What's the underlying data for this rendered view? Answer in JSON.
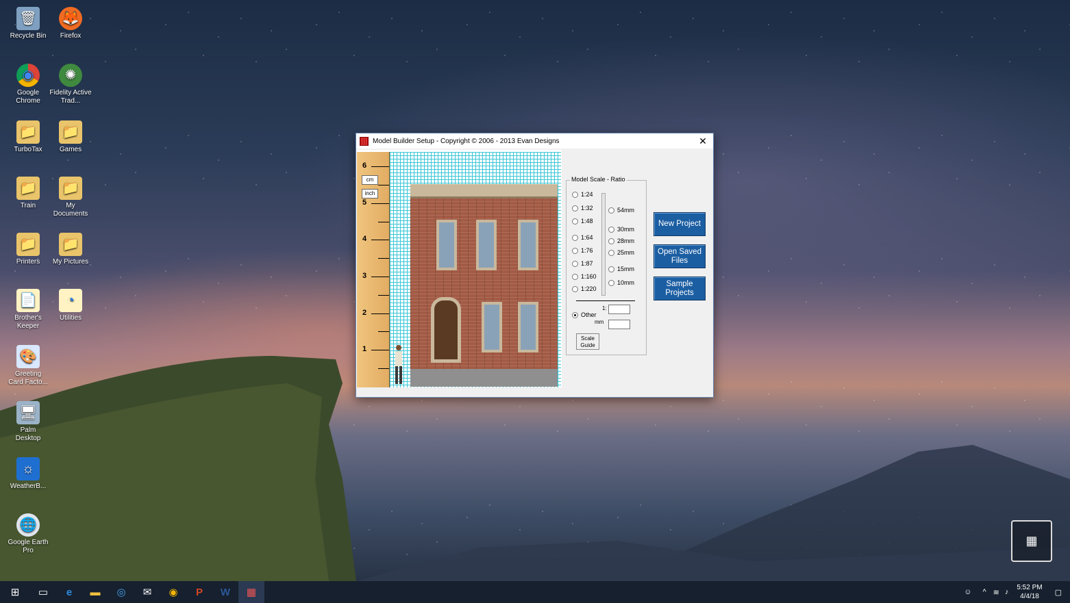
{
  "desktop": {
    "icons": [
      {
        "label": "Recycle Bin",
        "glyph": "🗑"
      },
      {
        "label": "Firefox",
        "glyph": "🦊"
      },
      {
        "label": "Google Chrome",
        "glyph": "◉"
      },
      {
        "label": "Fidelity Active Trad...",
        "glyph": "✺"
      },
      {
        "label": "TurboTax",
        "glyph": "📁"
      },
      {
        "label": "Games",
        "glyph": "📁"
      },
      {
        "label": "Train",
        "glyph": "📁"
      },
      {
        "label": "My Documents",
        "glyph": "📁"
      },
      {
        "label": "Printers",
        "glyph": "📁"
      },
      {
        "label": "My Pictures",
        "glyph": "📁"
      },
      {
        "label": "Brother's Keeper",
        "glyph": "📄"
      },
      {
        "label": "Utilities",
        "glyph": "◔"
      },
      {
        "label": "Greeting Card Facto...",
        "glyph": "🎨"
      },
      {
        "label": "Palm Desktop",
        "glyph": "🖥"
      },
      {
        "label": "WeatherB...",
        "glyph": "☼"
      },
      {
        "label": "Google Earth Pro",
        "glyph": "🌐"
      }
    ]
  },
  "window": {
    "title": "Model Builder Setup -  Copyright © 2006 - 2013 Evan Designs",
    "close_glyph": "✕",
    "ruler": {
      "numbers": [
        "6",
        "5",
        "4",
        "3",
        "2",
        "1"
      ],
      "unit_cm": "cm",
      "unit_inch": "inch"
    },
    "scale_group": {
      "label": "Model Scale - Ratio",
      "ratios": [
        "1:24",
        "1:32",
        "1:48",
        "1:64",
        "1:76",
        "1:87",
        "1:160",
        "1:220"
      ],
      "mm_options": [
        "54mm",
        "30mm",
        "28mm",
        "25mm",
        "15mm",
        "10mm"
      ],
      "other_label": "Other",
      "ratio_prefix": "1:",
      "mm_label": "mm",
      "scale_guide_label": "Scale Guide",
      "selected": "Other"
    },
    "buttons": {
      "new_project": "New Project",
      "open_saved": "Open Saved Files",
      "sample_projects": "Sample Projects"
    }
  },
  "taskbar": {
    "icons": [
      "windows-start",
      "task-view",
      "edge",
      "file-explorer",
      "safari",
      "mail",
      "chrome",
      "powerpoint",
      "word",
      "model-builder"
    ],
    "time": "5:52 PM",
    "date": "4/4/18"
  }
}
